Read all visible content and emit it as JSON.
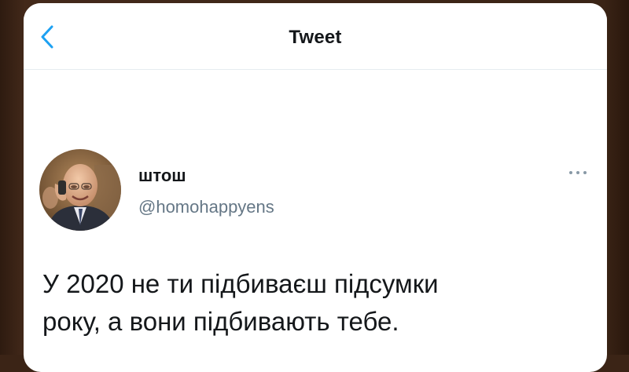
{
  "navbar": {
    "title": "Tweet",
    "back_icon": "chevron-left-icon",
    "accent_color": "#1da1f2"
  },
  "tweet": {
    "author": {
      "display_name": "штош",
      "handle": "@homohappyens"
    },
    "more_icon": "more-horizontal-icon",
    "text_lines": [
      "У 2020 не ти підбиваєш підсумки",
      "року, а вони підбивають тебе."
    ]
  }
}
